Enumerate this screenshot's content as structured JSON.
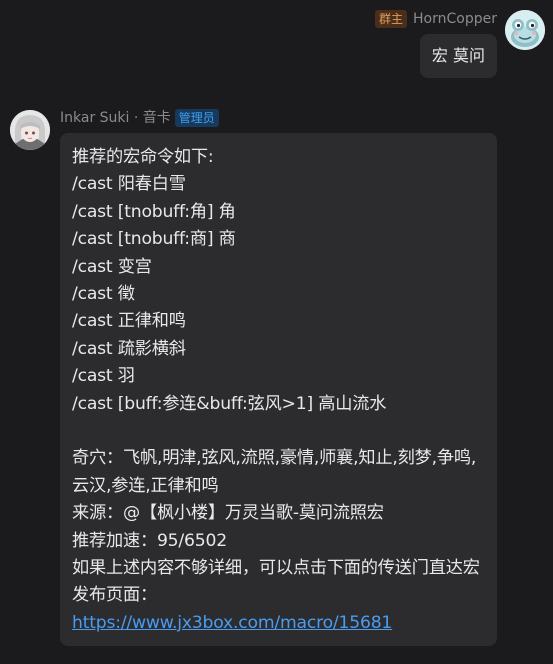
{
  "outgoing": {
    "sender": "HornCopper",
    "role_badge": "群主",
    "text": "宏 莫问"
  },
  "incoming": {
    "sender": "Inkar Suki · 音卡",
    "role_badge": "管理员",
    "lines": [
      "推荐的宏命令如下:",
      "/cast 阳春白雪",
      "/cast [tnobuff:角] 角",
      "/cast [tnobuff:商] 商",
      "/cast 变宫",
      "/cast 徵",
      "/cast 正律和鸣",
      "/cast 疏影横斜",
      "/cast 羽",
      "/cast [buff:参连&buff:弦风>1] 高山流水"
    ],
    "qixue": "奇穴：飞帆,明津,弦风,流照,豪情,师襄,知止,刻梦,争鸣,云汉,参连,正律和鸣",
    "source": "来源：@【枫小楼】万灵当歌-莫问流照宏",
    "speed": "推荐加速：95/6502",
    "hint": "如果上述内容不够详细，可以点击下面的传送门直达宏发布页面：",
    "link": "https://www.jx3box.com/macro/15681"
  },
  "colors": {
    "background": "#1b1b1d",
    "bubble": "#2c2c2e",
    "owner_badge_bg": "#4a2e1c",
    "owner_badge_fg": "#e39b5b",
    "admin_badge_bg": "#173a5c",
    "admin_badge_fg": "#3d9ff0",
    "link": "#4a9cf0"
  }
}
